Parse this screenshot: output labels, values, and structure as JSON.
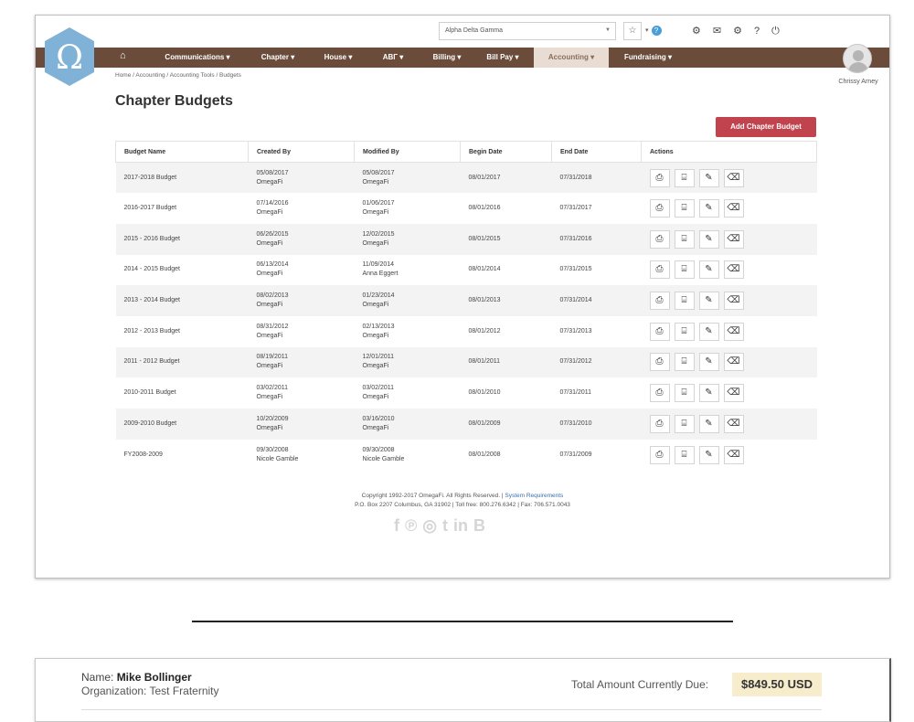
{
  "header": {
    "org_select": "Alpha Delta Gamma",
    "star_icon": "☆",
    "icons": [
      "bell-icon",
      "mail-icon",
      "gear-icon",
      "help-icon",
      "power-icon"
    ],
    "logo_letter": "Ω",
    "brand_color": "#6b4c3b",
    "logo_color": "#7fb2d6"
  },
  "nav": {
    "items": [
      {
        "label": "Communications ▾"
      },
      {
        "label": "Chapter ▾"
      },
      {
        "label": "House ▾"
      },
      {
        "label": "ΑΒΓ ▾"
      },
      {
        "label": "Billing ▾"
      },
      {
        "label": "Bill Pay ▾"
      },
      {
        "label": "Accounting ▾",
        "active": true
      },
      {
        "label": "Fundraising ▾"
      }
    ]
  },
  "user": {
    "name": "Chrissy Arney"
  },
  "breadcrumb": "Home / Accounting / Accounting Tools / Budgets",
  "page_title": "Chapter Budgets",
  "add_button": "Add Chapter Budget",
  "table": {
    "headers": [
      "Budget Name",
      "Created By",
      "Modified By",
      "Begin Date",
      "End Date",
      "Actions"
    ],
    "rows": [
      {
        "name": "2017-2018 Budget",
        "created_date": "05/08/2017",
        "created_by": "OmegaFi",
        "modified_date": "05/08/2017",
        "modified_by": "OmegaFi",
        "begin": "08/01/2017",
        "end": "07/31/2018"
      },
      {
        "name": "2016-2017 Budget",
        "created_date": "07/14/2016",
        "created_by": "OmegaFi",
        "modified_date": "01/06/2017",
        "modified_by": "OmegaFi",
        "begin": "08/01/2016",
        "end": "07/31/2017"
      },
      {
        "name": "2015 - 2016 Budget",
        "created_date": "06/26/2015",
        "created_by": "OmegaFi",
        "modified_date": "12/02/2015",
        "modified_by": "OmegaFi",
        "begin": "08/01/2015",
        "end": "07/31/2016"
      },
      {
        "name": "2014 - 2015 Budget",
        "created_date": "06/13/2014",
        "created_by": "OmegaFi",
        "modified_date": "11/09/2014",
        "modified_by": "Anna Eggert",
        "begin": "08/01/2014",
        "end": "07/31/2015"
      },
      {
        "name": "2013 - 2014 Budget",
        "created_date": "08/02/2013",
        "created_by": "OmegaFi",
        "modified_date": "01/23/2014",
        "modified_by": "OmegaFi",
        "begin": "08/01/2013",
        "end": "07/31/2014"
      },
      {
        "name": "2012 - 2013 Budget",
        "created_date": "08/31/2012",
        "created_by": "OmegaFi",
        "modified_date": "02/13/2013",
        "modified_by": "OmegaFi",
        "begin": "08/01/2012",
        "end": "07/31/2013"
      },
      {
        "name": "2011 - 2012 Budget",
        "created_date": "08/19/2011",
        "created_by": "OmegaFi",
        "modified_date": "12/01/2011",
        "modified_by": "OmegaFi",
        "begin": "08/01/2011",
        "end": "07/31/2012"
      },
      {
        "name": "2010-2011 Budget",
        "created_date": "03/02/2011",
        "created_by": "OmegaFi",
        "modified_date": "03/02/2011",
        "modified_by": "OmegaFi",
        "begin": "08/01/2010",
        "end": "07/31/2011"
      },
      {
        "name": "2009-2010 Budget",
        "created_date": "10/20/2009",
        "created_by": "OmegaFi",
        "modified_date": "03/16/2010",
        "modified_by": "OmegaFi",
        "begin": "08/01/2009",
        "end": "07/31/2010"
      },
      {
        "name": "FY2008-2009",
        "created_date": "09/30/2008",
        "created_by": "Nicole Gamble",
        "modified_date": "09/30/2008",
        "modified_by": "Nicole Gamble",
        "begin": "08/01/2008",
        "end": "07/31/2009"
      }
    ],
    "action_icons": [
      "pdf-icon",
      "excel-icon",
      "edit-icon",
      "delete-icon"
    ]
  },
  "footer": {
    "copyright": "Copyright 1992-2017 OmegaFi. All Rights Reserved. | ",
    "sysreq": "System Requirements",
    "address": "P.O. Box 2207 Columbus, GA 31902 | Toll free: 800.276.6342 | Fax: 706.571.0043",
    "socials": [
      "f",
      "℗",
      "◎",
      "t",
      "in",
      "B"
    ]
  },
  "bottom": {
    "name_label": "Name:",
    "name": "Mike Bollinger",
    "org_label": "Organization:",
    "org": "Test Fraternity",
    "due_label": "Total Amount Currently Due:",
    "due_amount": "$849.50 USD"
  }
}
